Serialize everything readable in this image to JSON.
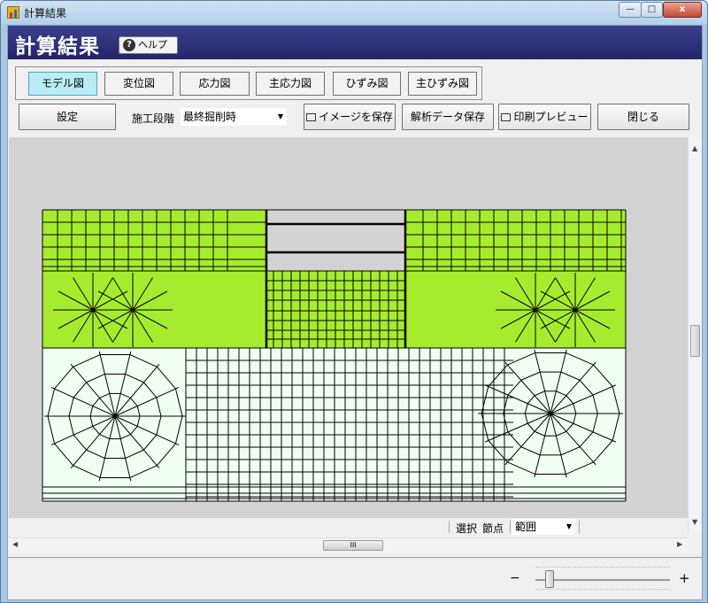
{
  "window": {
    "title": "計算結果",
    "min_label": "—",
    "max_label": "□",
    "close_label": "x"
  },
  "header": {
    "title": "計算結果",
    "help_label": "ヘルプ",
    "help_icon": "?"
  },
  "view_tabs": [
    {
      "label": "モデル図",
      "active": true
    },
    {
      "label": "変位図",
      "active": false
    },
    {
      "label": "応力図",
      "active": false
    },
    {
      "label": "主応力図",
      "active": false
    },
    {
      "label": "ひずみ図",
      "active": false
    },
    {
      "label": "主ひずみ図",
      "active": false
    }
  ],
  "toolbar": {
    "settings_label": "設定",
    "stage_label": "施工段階",
    "stage_value": "最終掘削時",
    "save_image_label": "イメージを保存",
    "save_data_label": "解析データ保存",
    "print_preview_label": "印刷プレビュー",
    "close_label": "閉じる"
  },
  "status": {
    "select_label": "選択",
    "node_label": "節点",
    "range_value": "範囲"
  },
  "hscroll": {
    "thumb_grip": "III"
  },
  "zoom": {
    "minus": "−",
    "plus": "+",
    "level": 0.08
  },
  "colors": {
    "upper_layer": "#a6ec2e",
    "lower_layer": "#f0fff2",
    "background": "#d3d3d3",
    "mesh_line": "#000000",
    "header_bg": "#2b2d78",
    "active_tab": "#b9ecf5"
  }
}
